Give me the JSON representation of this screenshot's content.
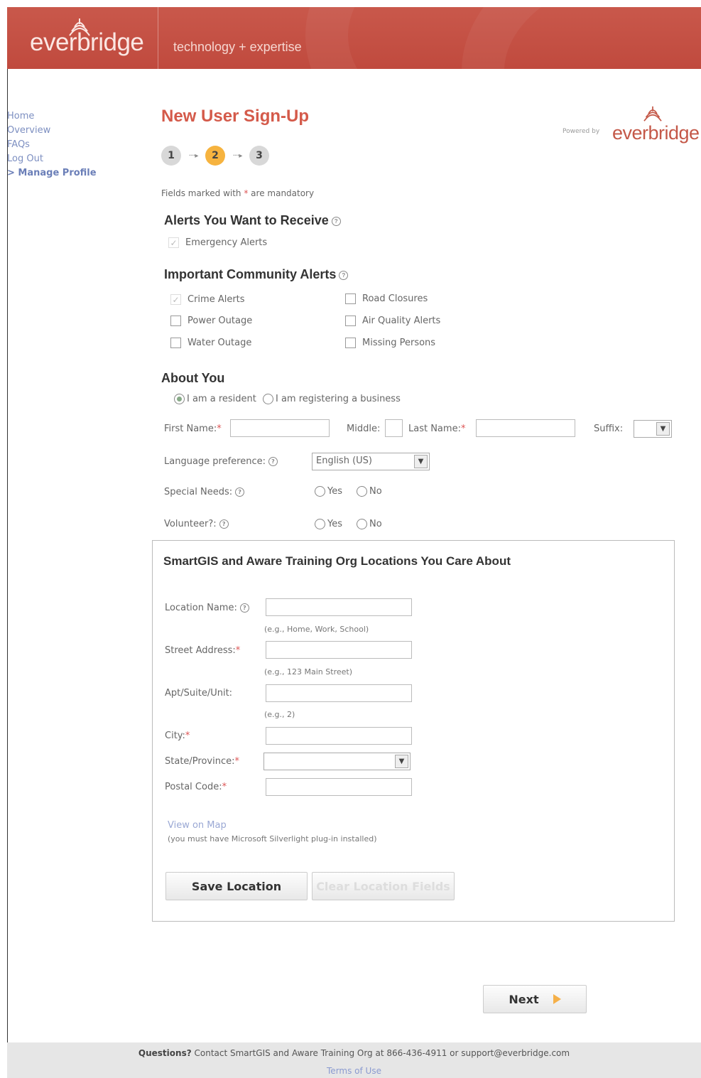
{
  "header": {
    "logo_text": "everbridge",
    "tagline": "technology + expertise"
  },
  "nav": {
    "items": [
      "Home",
      "Overview",
      "FAQs",
      "Log Out"
    ],
    "current": "> Manage Profile"
  },
  "page": {
    "title": "New User Sign-Up",
    "powered_by": "Powered by",
    "powered_brand": "everbridge",
    "steps": [
      "1",
      "2",
      "3"
    ],
    "active_step": "2",
    "mandatory_note_prefix": "Fields marked with ",
    "mandatory_star": "*",
    "mandatory_note_suffix": " are mandatory"
  },
  "alerts": {
    "title": "Alerts You Want to Receive",
    "emergency": "Emergency Alerts"
  },
  "community": {
    "title": "Important Community Alerts",
    "crime": "Crime Alerts",
    "power": "Power Outage",
    "water": "Water Outage",
    "road": "Road Closures",
    "air": "Air Quality Alerts",
    "missing": "Missing Persons"
  },
  "about": {
    "title": "About You",
    "resident": "I am a resident",
    "business": "I am registering a business",
    "first_name": "First Name:",
    "middle": "Middle:",
    "last_name": "Last Name:",
    "suffix": "Suffix:",
    "language_label": "Language preference:",
    "language_value": "English (US)",
    "special_needs": "Special Needs:",
    "volunteer": "Volunteer?:",
    "yes": "Yes",
    "no": "No"
  },
  "locations": {
    "title": "SmartGIS and Aware Training Org Locations You Care About",
    "location_name": "Location Name:",
    "location_hint": "(e.g., Home, Work, School)",
    "street": "Street Address:",
    "street_hint": "(e.g., 123 Main Street)",
    "apt": "Apt/Suite/Unit:",
    "apt_hint": "(e.g., 2)",
    "city": "City:",
    "state": "State/Province:",
    "postal": "Postal Code:",
    "view_map": "View on Map",
    "silverlight_note": "(you must have Microsoft Silverlight plug-in installed)",
    "save_button": "Save Location",
    "clear_button": "Clear Location Fields"
  },
  "actions": {
    "next": "Next"
  },
  "footer": {
    "questions_label": "Questions?",
    "questions_text": " Contact SmartGIS and Aware Training Org at 866-436-4911 or support@everbridge.com",
    "terms": "Terms of Use"
  },
  "colors": {
    "header": "#c4503f",
    "title": "#d45a4a",
    "active_step": "#f6b33f",
    "link": "#7d8fc1"
  }
}
